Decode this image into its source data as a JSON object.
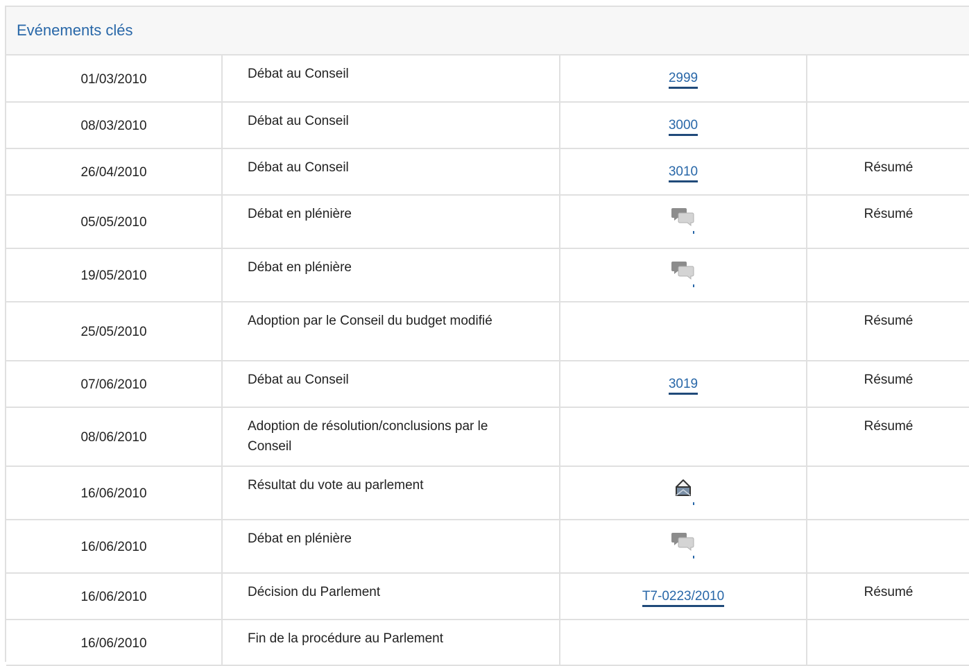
{
  "panel": {
    "title": "Evénements clés"
  },
  "events": [
    {
      "date": "01/03/2010",
      "event": "Débat au Conseil",
      "ref": {
        "type": "link",
        "text": "2999"
      },
      "summary": ""
    },
    {
      "date": "08/03/2010",
      "event": "Débat au Conseil",
      "ref": {
        "type": "link",
        "text": "3000"
      },
      "summary": ""
    },
    {
      "date": "26/04/2010",
      "event": "Débat au Conseil",
      "ref": {
        "type": "link",
        "text": "3010"
      },
      "summary": "Résumé"
    },
    {
      "date": "05/05/2010",
      "event": "Débat en plénière",
      "ref": {
        "type": "icon",
        "icon": "debate-icon"
      },
      "summary": "Résumé"
    },
    {
      "date": "19/05/2010",
      "event": "Débat en plénière",
      "ref": {
        "type": "icon",
        "icon": "debate-icon"
      },
      "summary": ""
    },
    {
      "date": "25/05/2010",
      "event": "Adoption par le Conseil du budget modifié",
      "ref": {
        "type": "none"
      },
      "summary": "Résumé"
    },
    {
      "date": "07/06/2010",
      "event": "Débat au Conseil",
      "ref": {
        "type": "link",
        "text": "3019"
      },
      "summary": "Résumé"
    },
    {
      "date": "08/06/2010",
      "event": "Adoption de résolution/conclusions par le Conseil",
      "ref": {
        "type": "none"
      },
      "summary": "Résumé"
    },
    {
      "date": "16/06/2010",
      "event": "Résultat du vote au parlement",
      "ref": {
        "type": "icon",
        "icon": "vote-icon"
      },
      "summary": ""
    },
    {
      "date": "16/06/2010",
      "event": "Débat en plénière",
      "ref": {
        "type": "icon",
        "icon": "debate-icon"
      },
      "summary": ""
    },
    {
      "date": "16/06/2010",
      "event": "Décision du Parlement",
      "ref": {
        "type": "link",
        "text": "T7-0223/2010"
      },
      "summary": "Résumé"
    },
    {
      "date": "16/06/2010",
      "event": "Fin de la procédure au Parlement",
      "ref": {
        "type": "none"
      },
      "summary": ""
    }
  ],
  "colors": {
    "link": "#2867a8",
    "title": "#2867a8",
    "border": "#e0e0e0",
    "header_bg": "#f7f7f7"
  }
}
